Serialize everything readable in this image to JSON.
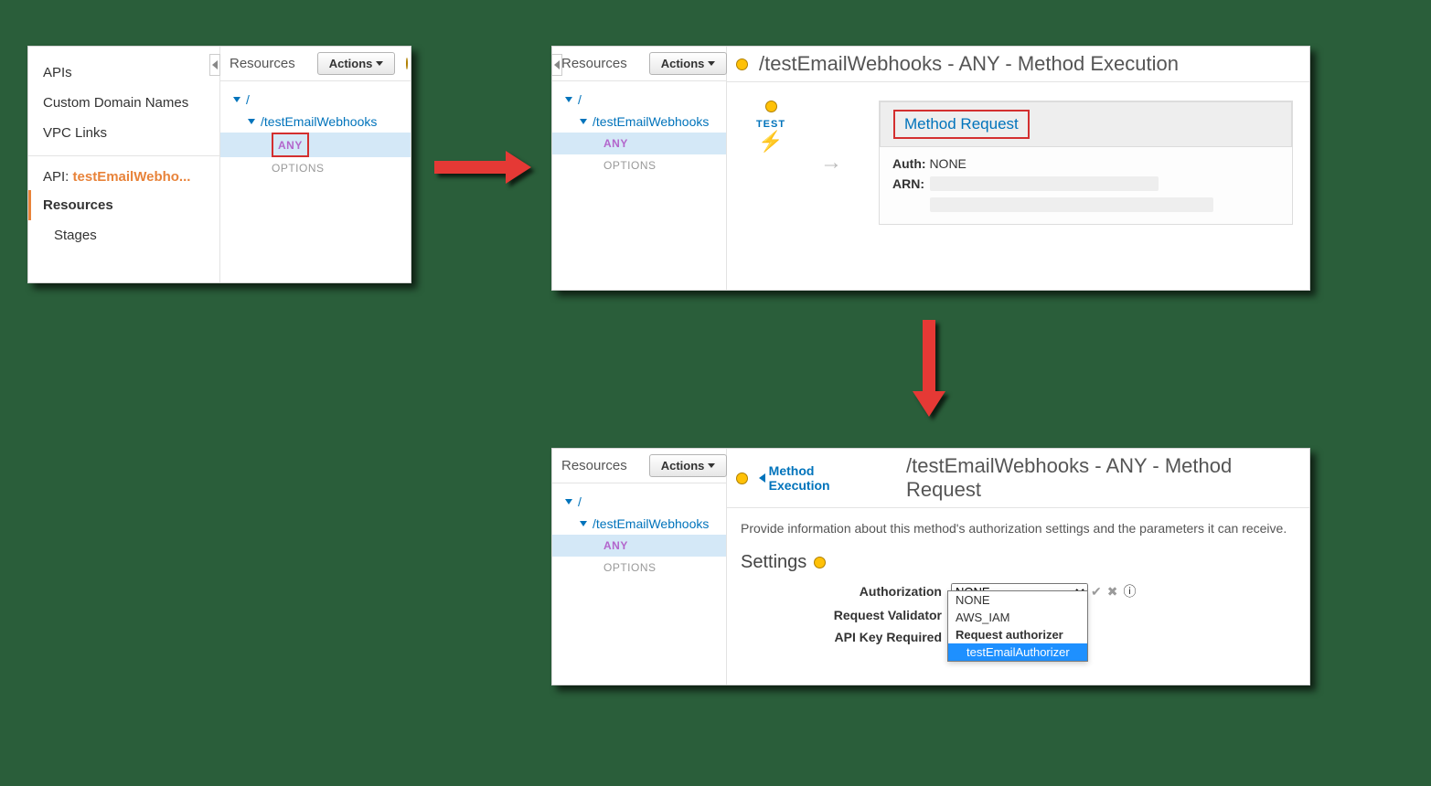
{
  "nav": {
    "apis": "APIs",
    "custom_domain": "Custom Domain Names",
    "vpc": "VPC Links",
    "api_prefix": "API: ",
    "api_name": "testEmailWebho...",
    "resources": "Resources",
    "stages": "Stages"
  },
  "resources_label": "Resources",
  "actions_label": "Actions",
  "tree": {
    "root": "/",
    "child": "/testEmailWebhooks",
    "any": "ANY",
    "options": "OPTIONS"
  },
  "panel2": {
    "title": "/testEmailWebhooks - ANY - Method Execution",
    "test": "TEST",
    "method_request": "Method Request",
    "auth_label": "Auth:",
    "auth_value": "NONE",
    "arn_label": "ARN:"
  },
  "panel3": {
    "back": "Method Execution",
    "title": "/testEmailWebhooks - ANY - Method Request",
    "desc": "Provide information about this method's authorization settings and the parameters it can receive.",
    "settings": "Settings",
    "authorization": "Authorization",
    "request_validator": "Request Validator",
    "api_key_required": "API Key Required",
    "authz_selected": "NONE",
    "options": {
      "none": "NONE",
      "iam": "AWS_IAM",
      "group": "Request authorizer",
      "authorizer": "testEmailAuthorizer"
    }
  }
}
